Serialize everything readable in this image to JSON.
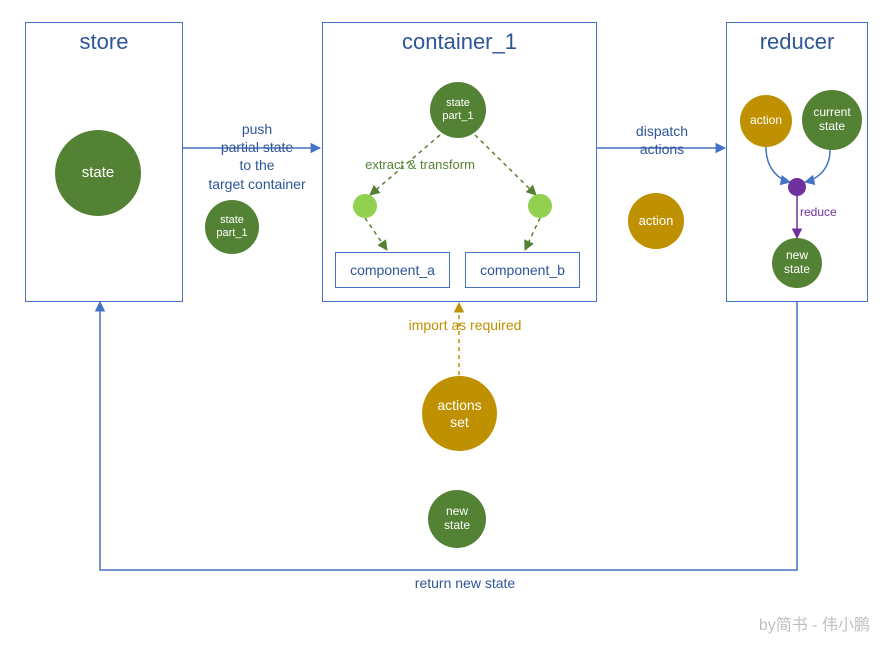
{
  "store": {
    "title": "store",
    "state_label": "state",
    "part_label": "state\npart_1"
  },
  "container": {
    "title": "container_1",
    "state_part_label": "state\npart_1",
    "extract_label": "extract & transform",
    "component_a": "component_a",
    "component_b": "component_b"
  },
  "reducer": {
    "title": "reducer",
    "action_label": "action",
    "current_state_label": "current\nstate",
    "reduce_label": "reduce",
    "new_state_label": "new\nstate"
  },
  "flow": {
    "push_label": "push\npartial state\nto the\ntarget container",
    "dispatch_label": "dispatch\nactions",
    "action_circle": "action",
    "import_label": "import as required",
    "actions_set_label": "actions\nset",
    "new_state_circle": "new\nstate",
    "return_label": "return new  state"
  },
  "credit": "by简书 - 伟小鹏"
}
